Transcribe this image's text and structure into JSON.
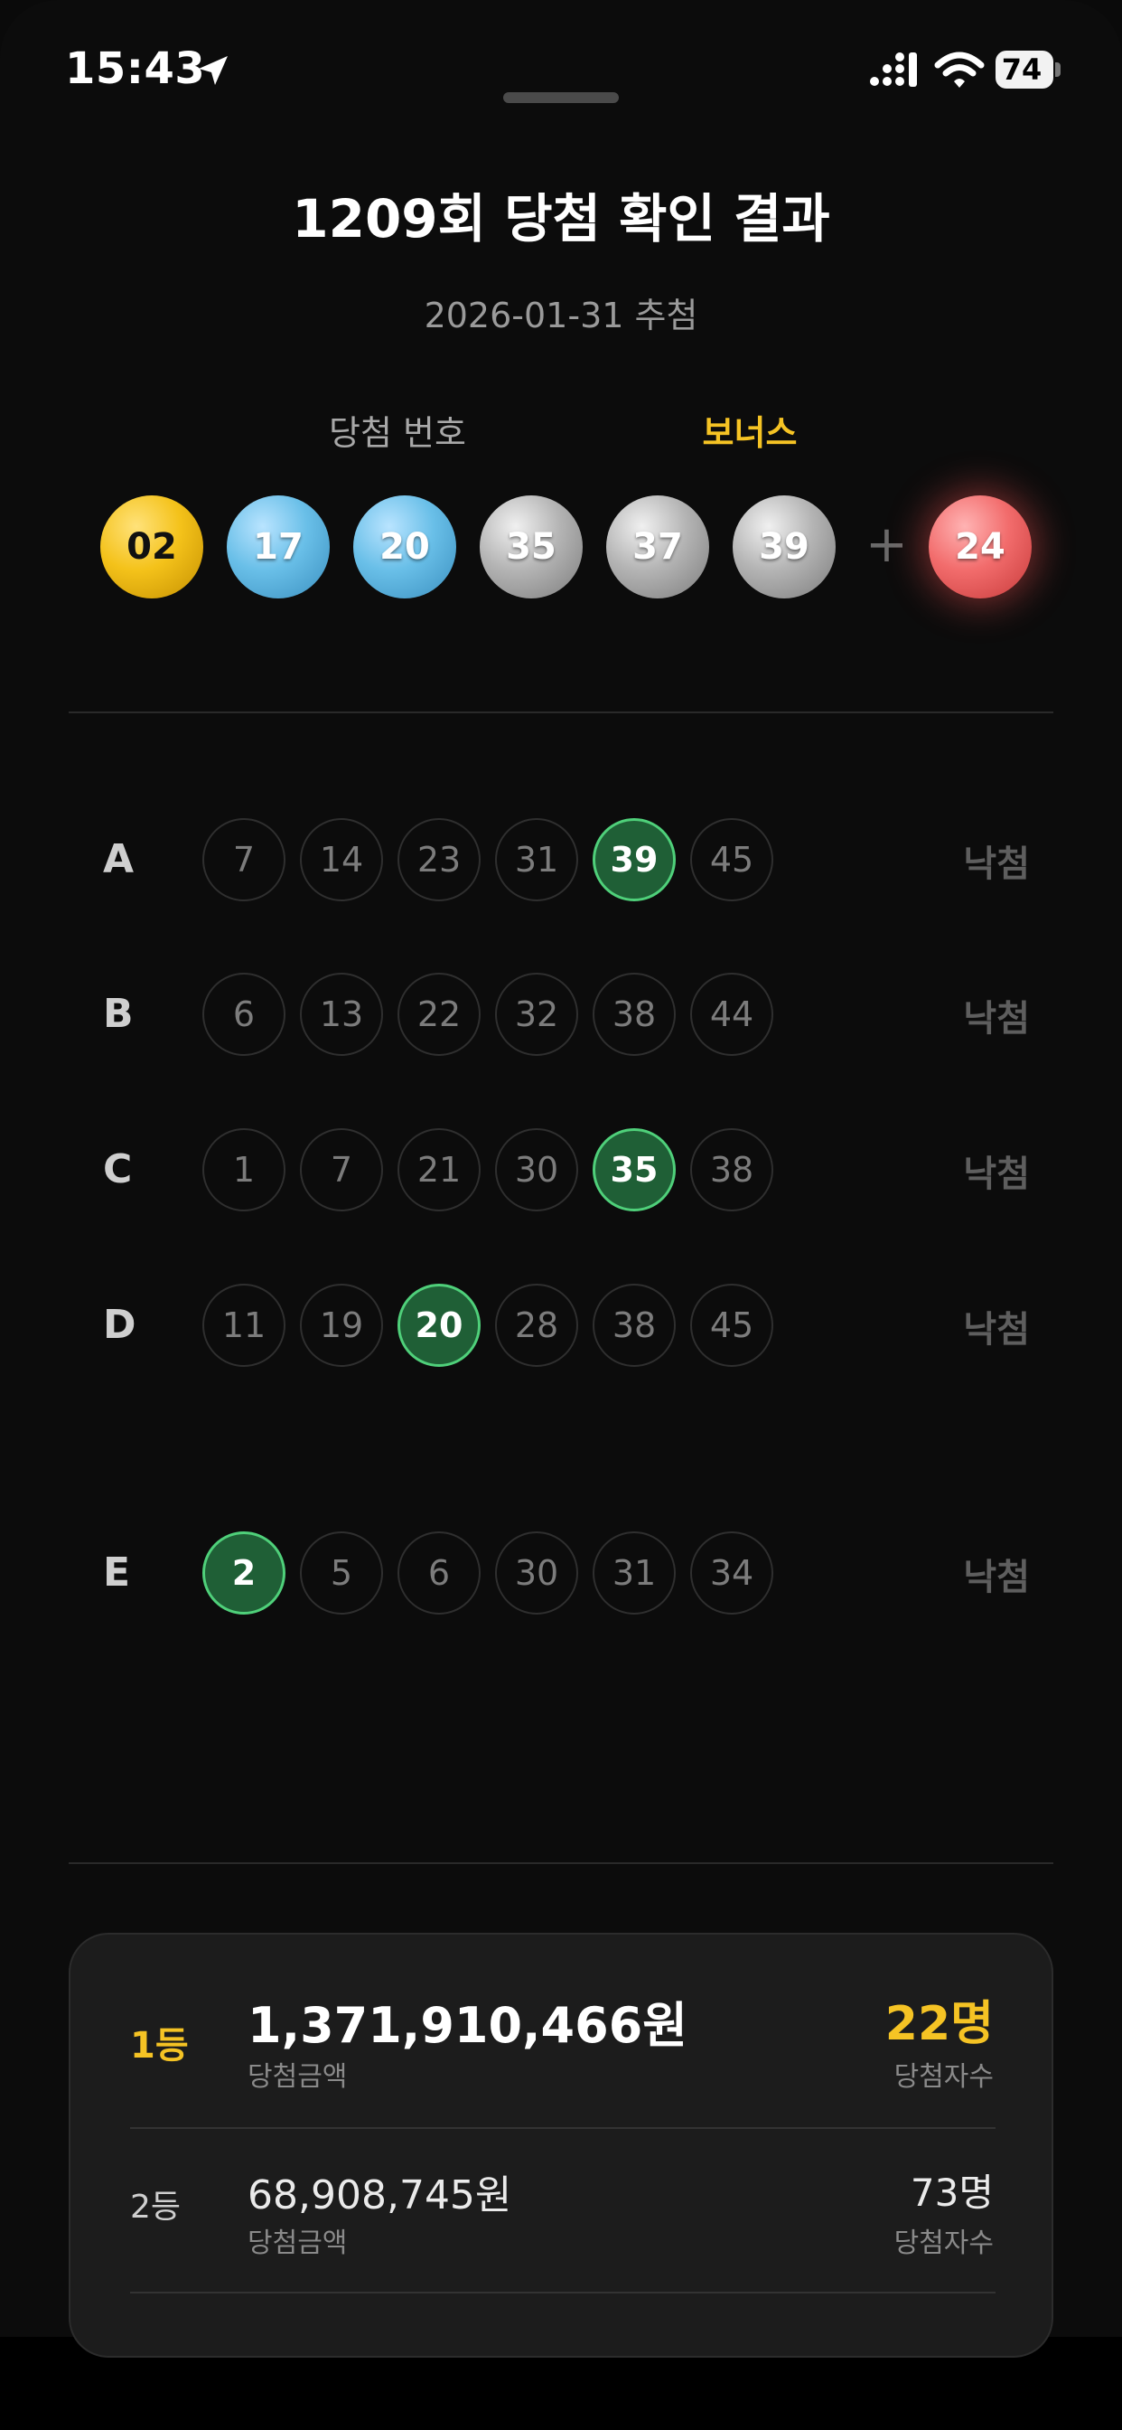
{
  "status_bar": {
    "time": "15:43",
    "battery": "74",
    "icons": [
      "location-arrow-icon",
      "signal-icon",
      "wifi-icon",
      "battery-icon"
    ]
  },
  "header": {
    "title": "1209회 당첨 확인 결과",
    "date": "2026-01-31 추첨"
  },
  "winning": {
    "label": "당첨 번호",
    "bonus_label": "보너스",
    "numbers": [
      {
        "value": "02",
        "color": "yellow"
      },
      {
        "value": "17",
        "color": "blue"
      },
      {
        "value": "20",
        "color": "blue"
      },
      {
        "value": "35",
        "color": "gray"
      },
      {
        "value": "37",
        "color": "gray"
      },
      {
        "value": "39",
        "color": "gray"
      }
    ],
    "plus": "+",
    "bonus": {
      "value": "24",
      "color": "red"
    }
  },
  "rows": [
    {
      "letter": "A",
      "numbers": [
        "7",
        "14",
        "23",
        "31",
        "39",
        "45"
      ],
      "hits": [
        4
      ],
      "result": "낙첨"
    },
    {
      "letter": "B",
      "numbers": [
        "6",
        "13",
        "22",
        "32",
        "38",
        "44"
      ],
      "hits": [],
      "result": "낙첨"
    },
    {
      "letter": "C",
      "numbers": [
        "1",
        "7",
        "21",
        "30",
        "35",
        "38"
      ],
      "hits": [
        4
      ],
      "result": "낙첨"
    },
    {
      "letter": "D",
      "numbers": [
        "11",
        "19",
        "20",
        "28",
        "38",
        "45"
      ],
      "hits": [
        2
      ],
      "result": "낙첨"
    },
    {
      "letter": "E",
      "numbers": [
        "2",
        "5",
        "6",
        "30",
        "31",
        "34"
      ],
      "hits": [
        0
      ],
      "result": "낙첨"
    }
  ],
  "prizes": [
    {
      "rank": "1등",
      "amount": "1,371,910,466원",
      "amount_label": "당첨금액",
      "winners": "22명",
      "winners_label": "당첨자수"
    },
    {
      "rank": "2등",
      "amount": "68,908,745원",
      "amount_label": "당첨금액",
      "winners": "73명",
      "winners_label": "당첨자수"
    }
  ],
  "colors": {
    "accent_yellow": "#f5c324",
    "hit_green": "#1f5f36",
    "hit_border": "#4fd07a",
    "bonus_red": "#f26c6c"
  }
}
